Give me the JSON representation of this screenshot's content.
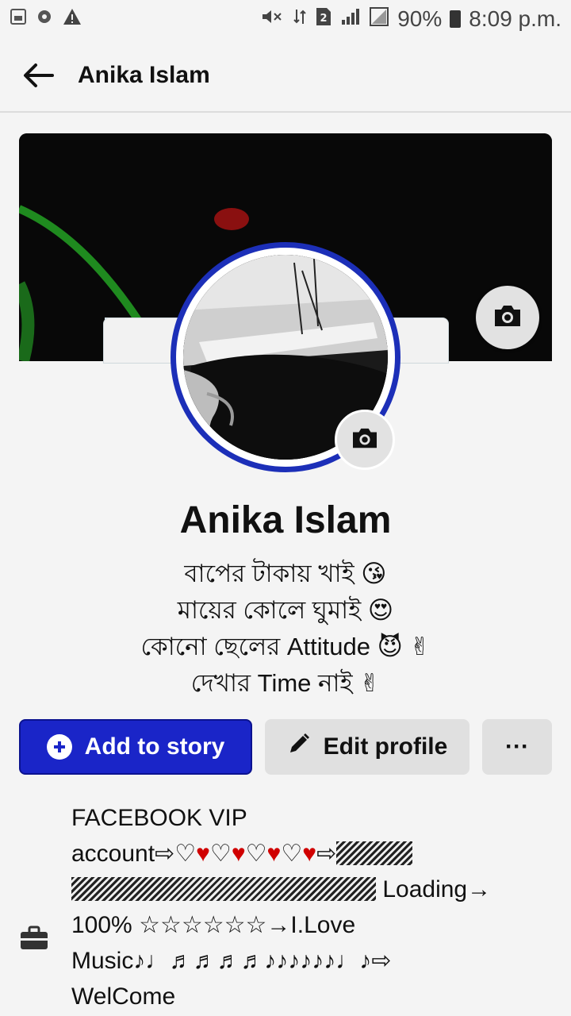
{
  "status_bar": {
    "battery": "90%",
    "time": "8:09 p.m."
  },
  "header": {
    "title": "Anika Islam"
  },
  "profile": {
    "name": "Anika Islam",
    "bio": [
      "বাপের টাকায় খাই 😘",
      "মায়ের কোলে ঘুমাই 😍",
      "কোনো ছেলের Attitude 😈 ✌",
      "দেখার Time নাই ✌"
    ]
  },
  "actions": {
    "add_story": "Add to story",
    "edit_profile": "Edit profile",
    "more": "···"
  },
  "work": {
    "line1": "FACEBOOK VIP",
    "line2_prefix": "account⇨♡",
    "line2_rest": "⇨",
    "line3_suffix": " Loading→",
    "line4": "100% ☆☆☆☆☆☆→I.Love",
    "line5": "Music♪♩♬♬♬♬♪♪♪♪♪♪♩♪⇨",
    "line6": "WelCome"
  },
  "icons": {
    "back": "arrow-left-icon",
    "camera": "camera-icon",
    "plus": "plus-circle-icon",
    "pencil": "pencil-icon",
    "briefcase": "briefcase-icon"
  },
  "colors": {
    "primary_button": "#1a25c8",
    "avatar_ring": "#1c2fb8",
    "heart": "#d00000"
  }
}
